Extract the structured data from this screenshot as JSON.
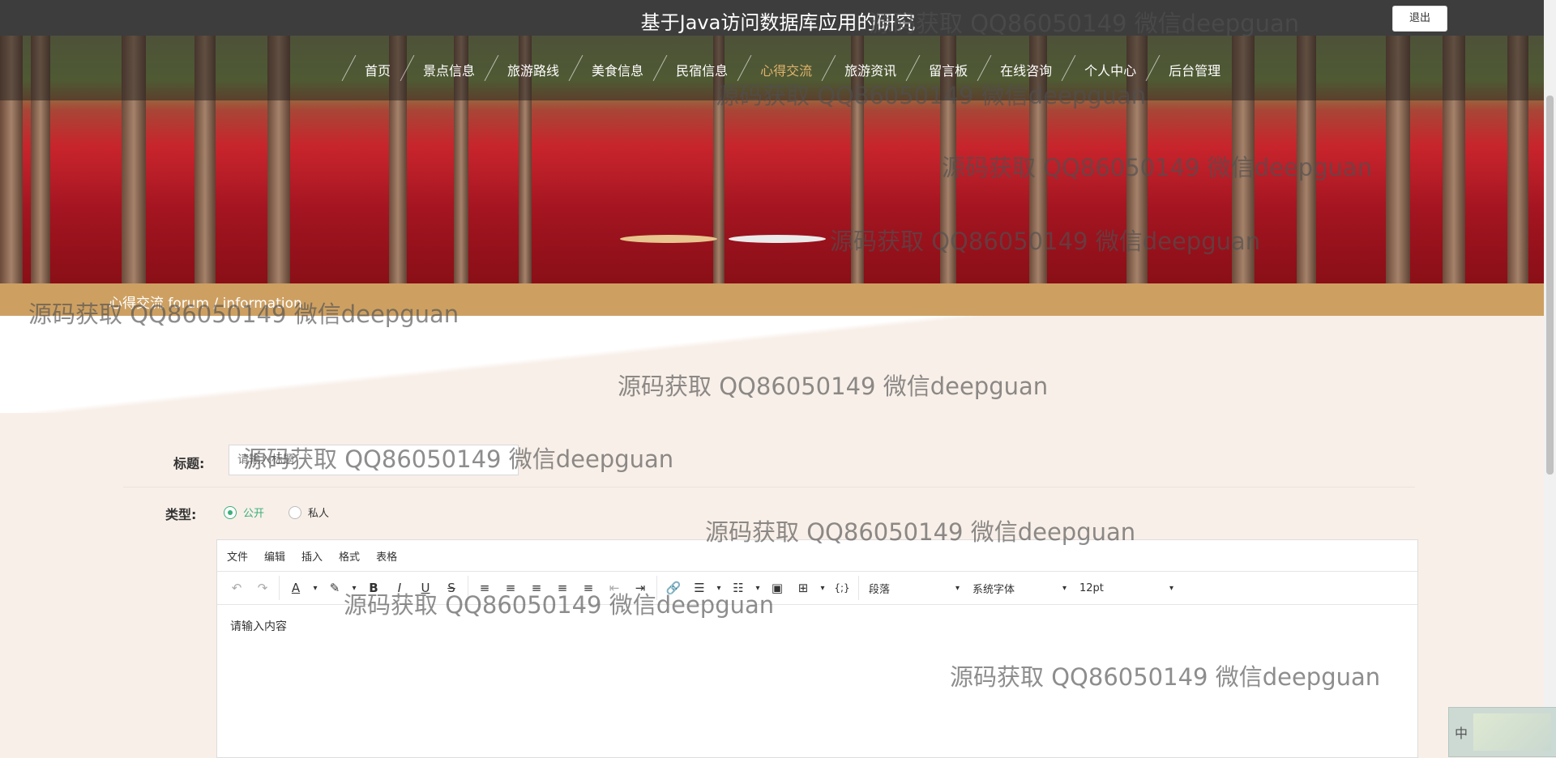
{
  "header": {
    "site_title": "基于Java访问数据库应用的研究",
    "logout_label": "退出"
  },
  "nav": {
    "items": [
      {
        "label": "首页"
      },
      {
        "label": "景点信息"
      },
      {
        "label": "旅游路线"
      },
      {
        "label": "美食信息"
      },
      {
        "label": "民宿信息"
      },
      {
        "label": "心得交流",
        "active": true
      },
      {
        "label": "旅游资讯"
      },
      {
        "label": "留言板"
      },
      {
        "label": "在线咨询"
      },
      {
        "label": "个人中心"
      },
      {
        "label": "后台管理"
      }
    ]
  },
  "breadcrumb": {
    "text": "心得交流  forum / information"
  },
  "form": {
    "title_label": "标题:",
    "title_placeholder": "请输入标题",
    "type_label": "类型:",
    "type_options": [
      {
        "label": "公开",
        "checked": true
      },
      {
        "label": "私人",
        "checked": false
      }
    ]
  },
  "editor": {
    "menus": [
      "文件",
      "编辑",
      "插入",
      "格式",
      "表格"
    ],
    "paragraph_select": "段落",
    "font_select": "系统字体",
    "size_select": "12pt",
    "content": "请输入内容"
  },
  "watermark": "源码获取 QQ86050149 微信deepguan",
  "ime": {
    "mode": "中"
  },
  "colors": {
    "accent": "#cda062",
    "nav_active": "#e0b36c",
    "topbar": "#3d3d3d",
    "radio_checked": "#3ab07a"
  }
}
